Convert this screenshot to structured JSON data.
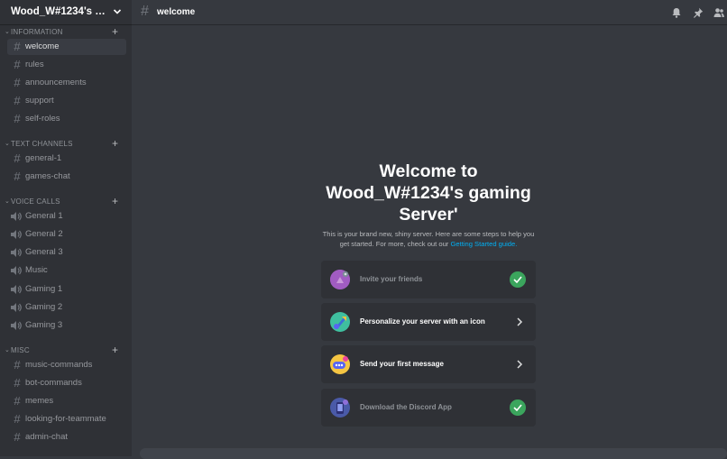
{
  "server": {
    "name": "Wood_W#1234's gaming Server'"
  },
  "sidebar": {
    "categories": [
      {
        "label": "INFORMATION",
        "channels": [
          {
            "label": "welcome"
          },
          {
            "label": "rules"
          },
          {
            "label": "announcements"
          },
          {
            "label": "support"
          },
          {
            "label": "self-roles"
          }
        ]
      },
      {
        "label": "TEXT CHANNELS",
        "channels": [
          {
            "label": "general-1"
          },
          {
            "label": "games-chat"
          }
        ]
      },
      {
        "label": "VOICE CALLS",
        "channels": [
          {
            "label": "General 1"
          },
          {
            "label": "General 2"
          },
          {
            "label": "General 3"
          },
          {
            "label": "Music"
          },
          {
            "label": "Gaming 1"
          },
          {
            "label": "Gaming 2"
          },
          {
            "label": "Gaming 3"
          }
        ]
      },
      {
        "label": "MISC",
        "channels": [
          {
            "label": "music-commands"
          },
          {
            "label": "bot-commands"
          },
          {
            "label": "memes"
          },
          {
            "label": "looking-for-teammate"
          },
          {
            "label": "admin-chat"
          }
        ]
      }
    ]
  },
  "topbar": {
    "channel_symbol": "#",
    "channel_name": "welcome"
  },
  "welcome": {
    "title": "Welcome to Wood_W#1234's gaming Server'",
    "description": "This is your brand new, shiny server. Here are some steps to help you get started. For more, check out our",
    "guide_link": "Getting Started guide.",
    "steps": [
      {
        "label": "Invite your friends",
        "completed": true
      },
      {
        "label": "Personalize your server with an icon",
        "completed": false
      },
      {
        "label": "Send your first message",
        "completed": false
      },
      {
        "label": "Download the Discord App",
        "completed": true
      }
    ]
  },
  "colors": {
    "accent_green": "#3ba55d",
    "link_blue": "#00b0f4",
    "background": "#36393f",
    "sidebar": "#2f3136"
  },
  "icons": [
    "chevron-down-icon",
    "plus-icon",
    "hash-icon",
    "speaker-icon",
    "bell-icon",
    "pin-icon",
    "members-icon",
    "check-icon",
    "chevron-right-icon"
  ]
}
